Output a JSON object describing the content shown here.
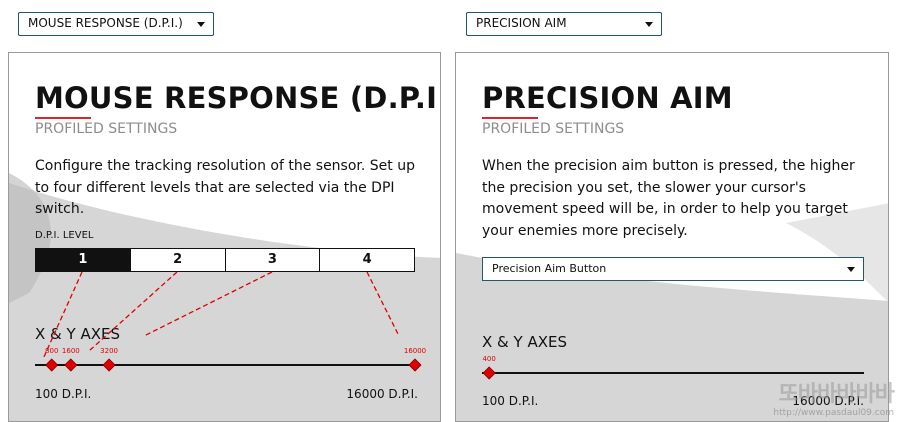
{
  "colors": {
    "accent_red": "#d9262d",
    "border_teal": "#1f5a6b",
    "marker_red": "#e00000"
  },
  "left": {
    "dropdown_value": "MOUSE RESPONSE (D.P.I.)",
    "title": "MOUSE RESPONSE (D.P.I.)",
    "subtitle": "PROFILED SETTINGS",
    "description": "Configure the tracking resolution of the sensor. Set up to four different levels that are selected via the DPI switch.",
    "level_label": "D.P.I. LEVEL",
    "levels": [
      {
        "label": "1",
        "active": true
      },
      {
        "label": "2",
        "active": false
      },
      {
        "label": "3",
        "active": false
      },
      {
        "label": "4",
        "active": false
      }
    ],
    "axes_label": "X & Y AXES",
    "markers": [
      {
        "label": "800",
        "value": 800
      },
      {
        "label": "1600",
        "value": 1600
      },
      {
        "label": "3200",
        "value": 3200
      },
      {
        "label": "16000",
        "value": 16000
      }
    ],
    "min_label": "100 D.P.I.",
    "max_label": "16000 D.P.I."
  },
  "right": {
    "dropdown_value": "PRECISION AIM",
    "title": "PRECISION AIM",
    "subtitle": "PROFILED SETTINGS",
    "description": "When the precision aim button is pressed, the higher the precision you set, the slower your cursor's movement speed will be, in order to help you target your enemies more precisely.",
    "button_select": "Precision Aim Button",
    "axes_label": "X & Y AXES",
    "marker": {
      "label": "400",
      "value": 400
    },
    "min_label": "100 D.P.I.",
    "max_label": "16000 D.P.I."
  },
  "watermark": {
    "main": "또바바바바바",
    "url": "http://www.pasdaul09.com"
  }
}
